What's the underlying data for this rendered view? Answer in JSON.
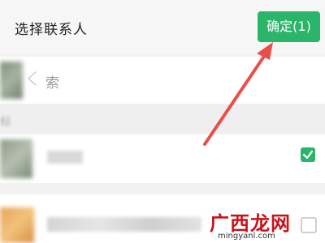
{
  "header": {
    "title": "选择联系人",
    "confirm_label": "确定(1)"
  },
  "search": {
    "partial_text": "索"
  },
  "section": {
    "label": "标"
  },
  "contacts": [
    {
      "checked": true
    },
    {
      "checked": false
    }
  ],
  "watermark": {
    "chinese": "广西龙网",
    "url": "mingyanl.com"
  },
  "colors": {
    "accent": "#2bb56b",
    "annotation_arrow": "#ea4e4b",
    "watermark": "#c8131c"
  }
}
